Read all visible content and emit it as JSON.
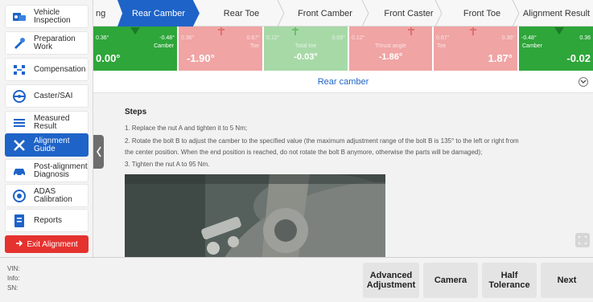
{
  "sidebar": {
    "items": [
      {
        "label": "Vehicle\nInspection"
      },
      {
        "label": "Preparation\nWork"
      },
      {
        "label": "Compensation"
      },
      {
        "label": "Caster/SAI"
      },
      {
        "label": "Measured\nResult"
      },
      {
        "label": "Alignment\nGuide"
      },
      {
        "label": "Post-alignment\nDiagnosis"
      },
      {
        "label": "ADAS\nCalibration"
      },
      {
        "label": "Reports"
      }
    ],
    "exit_label": "Exit Alignment"
  },
  "tabs": [
    {
      "label": "ng"
    },
    {
      "label": "Rear Camber"
    },
    {
      "label": "Rear Toe"
    },
    {
      "label": "Front Camber"
    },
    {
      "label": "Front Caster"
    },
    {
      "label": "Front Toe"
    },
    {
      "label": "Alignment Result"
    }
  ],
  "gauges": [
    {
      "left": "0.36°",
      "right": "-0.48°",
      "name": "Camber",
      "value": "0.00°",
      "color": "#2ea63a"
    },
    {
      "left": "0.36°",
      "right": "0.67°",
      "name": "Toe",
      "value": "-1.90°",
      "color": "#f0a4a4"
    },
    {
      "left": "0.12°",
      "right": "0.09°",
      "name": "Total toe",
      "value": "-0.03°",
      "color": "#a7d9a7"
    },
    {
      "left": "0.12°",
      "right": "",
      "name": "Thrust angle",
      "value": "-1.86°",
      "color": "#f0a4a4"
    },
    {
      "left": "0.67°",
      "right": "0.36°",
      "name": "Toe",
      "value": "1.87°",
      "color": "#f0a4a4"
    },
    {
      "left": "-0.48°",
      "right": "0.36",
      "name": "Camber",
      "value": "-0.02",
      "color": "#2ea63a"
    }
  ],
  "section": {
    "title": "Rear camber"
  },
  "steps": {
    "title": "Steps",
    "lines": [
      "1. Replace the nut A and tighten it to 5 Nm;",
      "2. Rotate the bolt B to adjust the camber to the specified value (the maximum adjustment range of the bolt B is 135° to the left or right from",
      "the center position. When the end position is reached, do not rotate the bolt B anymore, otherwise the parts will be damaged);",
      "3. Tighten the nut A to 95 Nm."
    ]
  },
  "vehicle": {
    "vin_label": "VIN:",
    "info_label": "Info:",
    "sn_label": "SN:"
  },
  "buttons": {
    "advanced": "Advanced\nAdjustment",
    "camera": "Camera",
    "half": "Half\nTolerance",
    "next": "Next"
  },
  "colors": {
    "accent": "#1e63c7",
    "exit": "#e5322f",
    "in_range": "#2ea63a",
    "out_of_range": "#f0a4a4"
  }
}
